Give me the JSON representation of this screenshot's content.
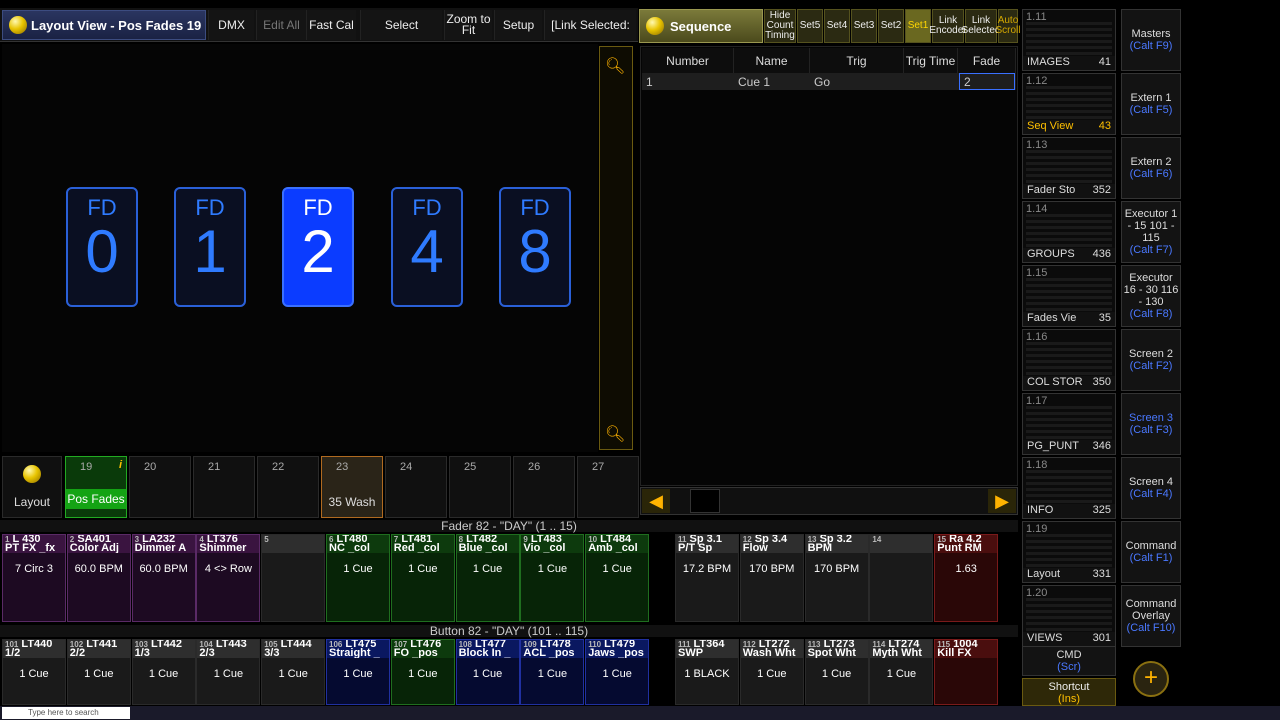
{
  "top": {
    "title": "Layout View - Pos Fades 19",
    "buttons": [
      "DMX",
      "Edit All",
      "Fast Cal",
      "Select",
      "Zoom to Fit",
      "Setup",
      "[Link Selected:"
    ]
  },
  "sequence": {
    "title": "Sequence",
    "mini_buttons": [
      "Hide Count Timing",
      "Set5",
      "Set4",
      "Set3",
      "Set2",
      "Set1",
      "Link Encoder",
      "Link Selected",
      "Auto Scroll"
    ],
    "columns": [
      "Number",
      "Name",
      "Trig",
      "Trig Time",
      "Fade"
    ],
    "rows": [
      {
        "number": "1",
        "name": "Cue 1",
        "trig": "Go",
        "trig_time": "",
        "fade": "2"
      }
    ]
  },
  "faders": [
    {
      "label": "FD",
      "value": "0"
    },
    {
      "label": "FD",
      "value": "1"
    },
    {
      "label": "FD",
      "value": "2",
      "active": true
    },
    {
      "label": "FD",
      "value": "4"
    },
    {
      "label": "FD",
      "value": "8"
    }
  ],
  "view_buttons": {
    "layout_label": "Layout",
    "items": [
      {
        "num": "19",
        "title": "Pos Fades"
      },
      {
        "num": "20",
        "title": ""
      },
      {
        "num": "21",
        "title": ""
      },
      {
        "num": "22",
        "title": ""
      },
      {
        "num": "23",
        "title": "35 Wash"
      },
      {
        "num": "24",
        "title": ""
      },
      {
        "num": "25",
        "title": ""
      },
      {
        "num": "26",
        "title": ""
      },
      {
        "num": "27",
        "title": ""
      }
    ]
  },
  "view_panels": [
    {
      "hd": "1.11",
      "name": "IMAGES",
      "n": "41"
    },
    {
      "hd": "1.12",
      "name": "Seq View",
      "n": "43",
      "sel": true
    },
    {
      "hd": "1.13",
      "name": "Fader Sto",
      "n": "352"
    },
    {
      "hd": "1.14",
      "name": "GROUPS",
      "n": "436"
    },
    {
      "hd": "1.15",
      "name": "Fades Vie",
      "n": "35"
    },
    {
      "hd": "1.16",
      "name": "COL STOR",
      "n": "350"
    },
    {
      "hd": "1.17",
      "name": "PG_PUNT",
      "n": "346"
    },
    {
      "hd": "1.18",
      "name": "INFO",
      "n": "325"
    },
    {
      "hd": "1.19",
      "name": "Layout",
      "n": "331"
    },
    {
      "hd": "1.20",
      "name": "VIEWS",
      "n": "301"
    }
  ],
  "right_buttons": [
    {
      "t": "Masters",
      "k": "(Calt F9)"
    },
    {
      "t": "Extern 1",
      "k": "(Calt F5)"
    },
    {
      "t": "Extern 2",
      "k": "(Calt F6)"
    },
    {
      "t": "Executor 1 - 15 101 - 115",
      "k": "(Calt F7)"
    },
    {
      "t": "Executor 16 - 30 116 - 130",
      "k": "(Calt F8)"
    },
    {
      "t": "Screen 2",
      "k": "(Calt F2)"
    },
    {
      "t": "Screen 3",
      "k": "(Calt F3)"
    },
    {
      "t": "Screen 4",
      "k": "(Calt F4)"
    },
    {
      "t": "Command",
      "k": "(Calt F1)"
    },
    {
      "t": "Command Overlay",
      "k": "(Calt F10)"
    }
  ],
  "cmd": {
    "label": "CMD",
    "sub": "(Scr)"
  },
  "shortcut": {
    "label": "Shortcut",
    "sub": "(Ins)"
  },
  "fader_header": "Fader 82 - \"DAY\" (1 .. 15)",
  "button_header": "Button 82 - \"DAY\" (101 .. 115)",
  "fader_execs": [
    {
      "num": "1",
      "name": "L 430",
      "sub": "PT FX _fx",
      "cue": "7 Circ 3",
      "c": "purple"
    },
    {
      "num": "2",
      "name": "SA401",
      "sub": "Color Adj",
      "cue": "60.0 BPM",
      "c": "purple"
    },
    {
      "num": "3",
      "name": "LA232",
      "sub": "Dimmer A",
      "cue": "60.0 BPM",
      "c": "purple"
    },
    {
      "num": "4",
      "name": "LT376",
      "sub": "Shimmer",
      "cue": "4 <> Row",
      "c": "purple"
    },
    {
      "num": "5",
      "name": "",
      "sub": "",
      "cue": "",
      "c": "gray"
    },
    {
      "num": "6",
      "name": "LT480",
      "sub": "NC _col",
      "cue": "1 Cue",
      "c": "green"
    },
    {
      "num": "7",
      "name": "LT481",
      "sub": "Red _col",
      "cue": "1 Cue",
      "c": "green"
    },
    {
      "num": "8",
      "name": "LT482",
      "sub": "Blue _col",
      "cue": "1 Cue",
      "c": "green"
    },
    {
      "num": "9",
      "name": "LT483",
      "sub": "Vio _col",
      "cue": "1 Cue",
      "c": "green"
    },
    {
      "num": "10",
      "name": "LT484",
      "sub": "Amb _col",
      "cue": "1 Cue",
      "c": "green"
    },
    {
      "num": "11",
      "name": "Sp 3.1",
      "sub": "P/T Sp",
      "cue": "17.2 BPM",
      "c": "gray"
    },
    {
      "num": "12",
      "name": "Sp 3.4",
      "sub": "Flow",
      "cue": "170 BPM",
      "c": "gray"
    },
    {
      "num": "13",
      "name": "Sp 3.2",
      "sub": "BPM",
      "cue": "170 BPM",
      "c": "gray"
    },
    {
      "num": "14",
      "name": "",
      "sub": "",
      "cue": "",
      "c": "gray"
    },
    {
      "num": "15",
      "name": "Ra 4.2",
      "sub": "Punt RM",
      "cue": "1.63",
      "c": "red"
    }
  ],
  "button_execs": [
    {
      "num": "101",
      "name": "LT440",
      "sub": "1/2",
      "cue": "1 Cue",
      "c": "gray"
    },
    {
      "num": "102",
      "name": "LT441",
      "sub": "2/2",
      "cue": "1 Cue",
      "c": "gray"
    },
    {
      "num": "103",
      "name": "LT442",
      "sub": "1/3",
      "cue": "1 Cue",
      "c": "gray"
    },
    {
      "num": "104",
      "name": "LT443",
      "sub": "2/3",
      "cue": "1 Cue",
      "c": "gray"
    },
    {
      "num": "105",
      "name": "LT444",
      "sub": "3/3",
      "cue": "1 Cue",
      "c": "gray"
    },
    {
      "num": "106",
      "name": "LT475",
      "sub": "Straight _",
      "cue": "1 Cue",
      "c": "blue"
    },
    {
      "num": "107",
      "name": "LT476",
      "sub": "FO _pos",
      "cue": "1 Cue",
      "c": "green"
    },
    {
      "num": "108",
      "name": "LT477",
      "sub": "Block In _",
      "cue": "1 Cue",
      "c": "blue"
    },
    {
      "num": "109",
      "name": "LT478",
      "sub": "ACL _pos",
      "cue": "1 Cue",
      "c": "blue"
    },
    {
      "num": "110",
      "name": "LT479",
      "sub": "Jaws _pos",
      "cue": "1 Cue",
      "c": "blue"
    },
    {
      "num": "111",
      "name": "LT364",
      "sub": "SWP",
      "cue": "1 BLACK",
      "c": "gray"
    },
    {
      "num": "112",
      "name": "LT272",
      "sub": "Wash Wht",
      "cue": "1 Cue",
      "c": "gray"
    },
    {
      "num": "113",
      "name": "LT273",
      "sub": "Spot Wht",
      "cue": "1 Cue",
      "c": "gray"
    },
    {
      "num": "114",
      "name": "LT274",
      "sub": "Myth Wht",
      "cue": "1 Cue",
      "c": "gray"
    },
    {
      "num": "115",
      "name": "1004",
      "sub": "Kill FX",
      "cue": "",
      "c": "red"
    }
  ],
  "taskbar": {
    "search_placeholder": "Type here to search"
  }
}
